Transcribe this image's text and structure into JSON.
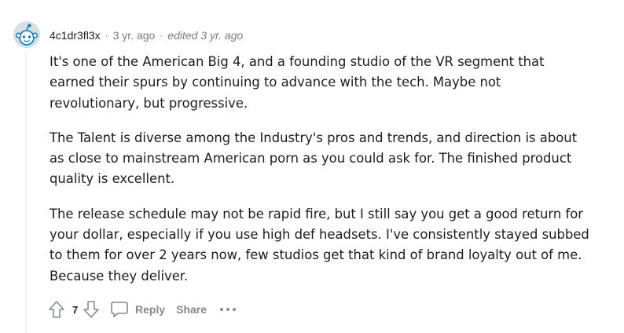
{
  "comment": {
    "author": "4c1dr3fl3x",
    "separator": "·",
    "time": "3 yr. ago",
    "edited": "edited 3 yr. ago",
    "paragraphs": [
      "It's one of the American Big 4, and a founding studio of the VR segment that earned their spurs by continuing to advance with the tech. Maybe not revolutionary, but progressive.",
      "The Talent is diverse among the Industry's pros and trends, and direction is about as close to mainstream American porn as you could ask for. The finished product quality is excellent.",
      "The release schedule may not be rapid fire, but I still say you get a good return for your dollar, especially if you use high def headsets. I've consistently stayed subbed to them for over 2 years now, few studios get that kind of brand loyalty out of me. Because they deliver."
    ],
    "score": "7",
    "actions": {
      "reply_label": "Reply",
      "share_label": "Share"
    }
  },
  "icons": {
    "avatar": "snoo-avatar-icon",
    "upvote": "upvote-arrow-icon",
    "downvote": "downvote-arrow-icon",
    "reply": "speech-bubble-icon",
    "more": "ellipsis-icon"
  },
  "colors": {
    "text": "#1c1c1c",
    "meta": "#787c7e",
    "action": "#878a8c",
    "avatar_bg": "#d7dfe2",
    "avatar_accent": "#0079d3",
    "thread_line": "#edeff1"
  }
}
